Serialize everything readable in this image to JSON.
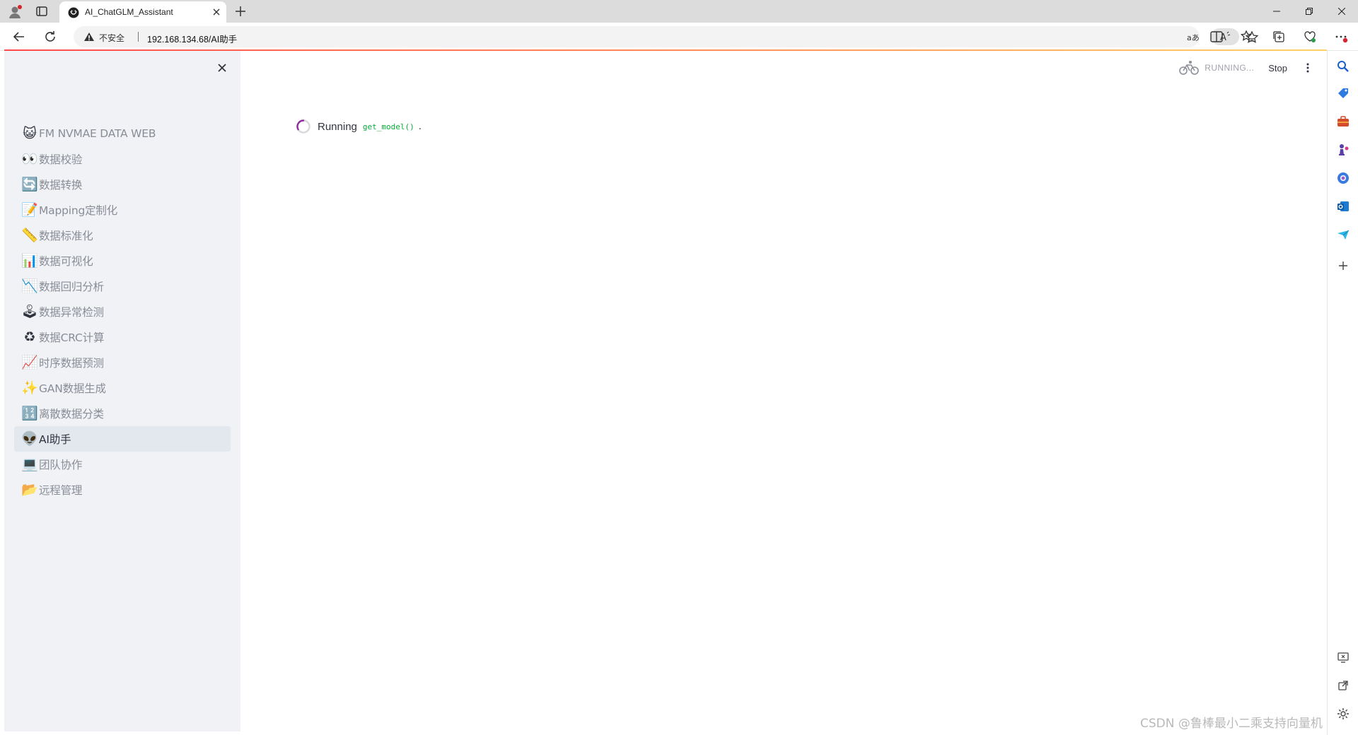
{
  "browser": {
    "tab_title": "AI_ChatGLM_Assistant",
    "security_label": "不安全",
    "url": "192.168.134.68/AI助手"
  },
  "app": {
    "status": {
      "running_label": "RUNNING...",
      "stop_label": "Stop"
    },
    "sidebar": {
      "items": [
        {
          "icon": "😺",
          "label": "FM NVMAE DATA WEB",
          "active": false
        },
        {
          "icon": "👀",
          "label": "数据校验",
          "active": false
        },
        {
          "icon": "🔄",
          "label": "数据转换",
          "active": false
        },
        {
          "icon": "📝",
          "label": "Mapping定制化",
          "active": false
        },
        {
          "icon": "📏",
          "label": "数据标准化",
          "active": false
        },
        {
          "icon": "📊",
          "label": "数据可视化",
          "active": false
        },
        {
          "icon": "📉",
          "label": "数据回归分析",
          "active": false
        },
        {
          "icon": "🕹",
          "label": "数据异常检测",
          "active": false
        },
        {
          "icon": "♻",
          "label": "数据CRC计算",
          "active": false
        },
        {
          "icon": "📈",
          "label": "时序数据预测",
          "active": false
        },
        {
          "icon": "✨",
          "label": "GAN数据生成",
          "active": false
        },
        {
          "icon": "🔢",
          "label": "离散数据分类",
          "active": false
        },
        {
          "icon": "👽",
          "label": "AI助手",
          "active": true
        },
        {
          "icon": "💻",
          "label": "团队协作",
          "active": false
        },
        {
          "icon": "📂",
          "label": "远程管理",
          "active": false
        }
      ]
    },
    "main": {
      "running_text": "Running",
      "running_code": "get_model()",
      "running_suffix": "."
    }
  },
  "watermark": "CSDN @鲁棒最小二乘支持向量机",
  "colors": {
    "accent_red": "#ff4b4b",
    "sidebar_bg": "#f0f2f6",
    "code_green": "#09ab3b",
    "spinner_purple": "#8e2d9c"
  }
}
